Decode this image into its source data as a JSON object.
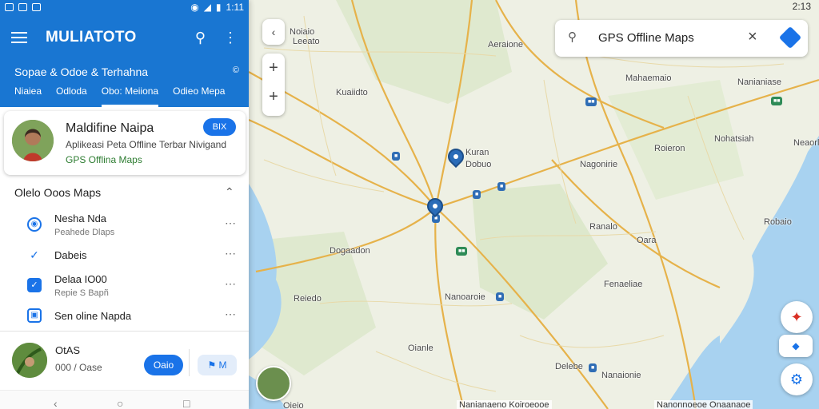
{
  "status_bar": {
    "time_left": "1:11",
    "time_right": "2:13"
  },
  "app": {
    "title": "MULIATOTO",
    "subtitle": "Sopae & Odoe & Terhahna",
    "subtitle_end": "©",
    "tabs": [
      "Niaiea",
      "Odloda",
      "Obo: Meiiona",
      "Odieo Mepa"
    ],
    "active_tab": 2
  },
  "profile_card": {
    "name": "Maldifine Naipa",
    "description": "Aplikeasi Peta Offline Terbar Nivigand",
    "tag": "GPS Offlina Maps",
    "button_label": "BIX"
  },
  "section": {
    "title": "Olelo Ooos Maps"
  },
  "list_items": [
    {
      "icon": "location-circle-icon",
      "title": "Nesha Nda",
      "subtitle": "Peahede Dlaps"
    },
    {
      "icon": "route-check-icon",
      "title": "Dabeis",
      "subtitle": ""
    },
    {
      "icon": "checkbox-icon",
      "title": "Delaa IO00",
      "subtitle": "Repie S Bapñ"
    },
    {
      "icon": "map-book-icon",
      "title": "Sen oline Napda",
      "subtitle": ""
    }
  ],
  "bottom_card": {
    "title": "OtAS",
    "subtitle": "000 / Oase",
    "primary_button": "Oaio",
    "secondary_button": "M"
  },
  "search": {
    "query": "GPS Offline Maps"
  },
  "map_labels": [
    "Noiaio",
    "Leeato",
    "Aeraione",
    "Mahaemaio",
    "Nanianiase",
    "Kuaiidto",
    "Kuran",
    "Dobuo",
    "Nagonirie",
    "Roieron",
    "Nohatsiah",
    "Ranalo",
    "Robaio",
    "Dogaadon",
    "Nanoaroie",
    "Fenaeliae",
    "Reiedo",
    "Oianle",
    "Delebe",
    "Oara",
    "Neaorl",
    "Oieio",
    "Nanaionie"
  ],
  "attribution": "Nanianaeno Koiroeooe",
  "attribution_right": "Nanonnoeoe Onaanaoe"
}
